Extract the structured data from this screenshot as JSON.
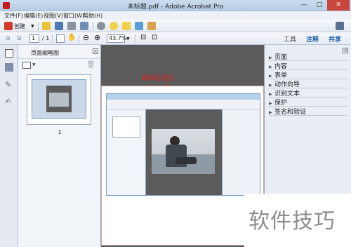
{
  "window": {
    "title": "未标题.pdf - Adobe Acrobat Pro",
    "min_label": "—",
    "max_label": "□",
    "close_label": "✕"
  },
  "menu": [
    "文件(F)",
    "编辑(E)",
    "视图(V)",
    "窗口(W)",
    "帮助(H)"
  ],
  "toolbar": {
    "create_label": "创建"
  },
  "nav": {
    "page_current": "1",
    "page_total": "/ 1",
    "zoom": "43.7%",
    "tabs": [
      "工具",
      "注释",
      "共享"
    ]
  },
  "thumbnail_panel": {
    "title": "页面缩略图",
    "page_label": "1"
  },
  "document": {
    "annotation_text": "跳到后退回"
  },
  "right_panel": {
    "items": [
      "页面",
      "内容",
      "表单",
      "动作向导",
      "识别文本",
      "保护",
      "签名和验证"
    ]
  },
  "watermark": {
    "text": "软件技巧"
  },
  "colors": {
    "accent": "#2060b0",
    "annotation": "#e02020",
    "close": "#c9463d"
  }
}
